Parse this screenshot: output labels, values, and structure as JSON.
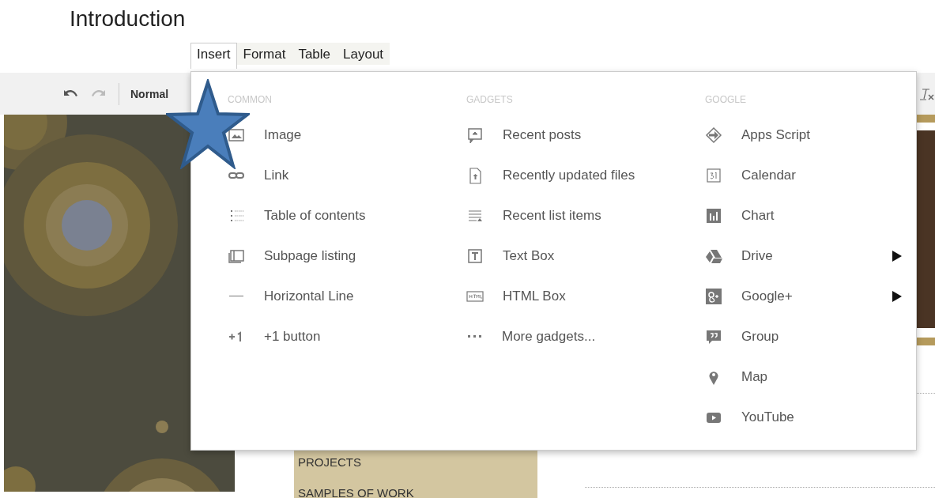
{
  "page_title": "Introduction",
  "menu_tabs": [
    {
      "label": "Insert",
      "selected": true
    },
    {
      "label": "Format",
      "selected": false
    },
    {
      "label": "Table",
      "selected": false
    },
    {
      "label": "Layout",
      "selected": false
    }
  ],
  "toolbar": {
    "paragraph_style": "Normal"
  },
  "insert_menu": {
    "columns": [
      {
        "heading": "COMMON",
        "items": [
          {
            "label": "Image",
            "submenu": false
          },
          {
            "label": "Link",
            "submenu": false
          },
          {
            "label": "Table of contents",
            "submenu": false
          },
          {
            "label": "Subpage listing",
            "submenu": false
          },
          {
            "label": "Horizontal Line",
            "submenu": false
          },
          {
            "label": "+1 button",
            "submenu": false
          }
        ]
      },
      {
        "heading": "GADGETS",
        "items": [
          {
            "label": "Recent posts",
            "submenu": false
          },
          {
            "label": "Recently updated files",
            "submenu": false
          },
          {
            "label": "Recent list items",
            "submenu": false
          },
          {
            "label": "Text Box",
            "submenu": false
          },
          {
            "label": "HTML Box",
            "submenu": false
          },
          {
            "label": "More gadgets...",
            "submenu": false
          }
        ]
      },
      {
        "heading": "GOOGLE",
        "items": [
          {
            "label": "Apps Script",
            "submenu": false
          },
          {
            "label": "Calendar",
            "submenu": false
          },
          {
            "label": "Chart",
            "submenu": false
          },
          {
            "label": "Drive",
            "submenu": true
          },
          {
            "label": "Google+",
            "submenu": true
          },
          {
            "label": "Group",
            "submenu": false
          },
          {
            "label": "Map",
            "submenu": false
          },
          {
            "label": "YouTube",
            "submenu": false
          }
        ]
      }
    ]
  },
  "site_nav": [
    "PROJECTS",
    "SAMPLES OF WORK"
  ]
}
